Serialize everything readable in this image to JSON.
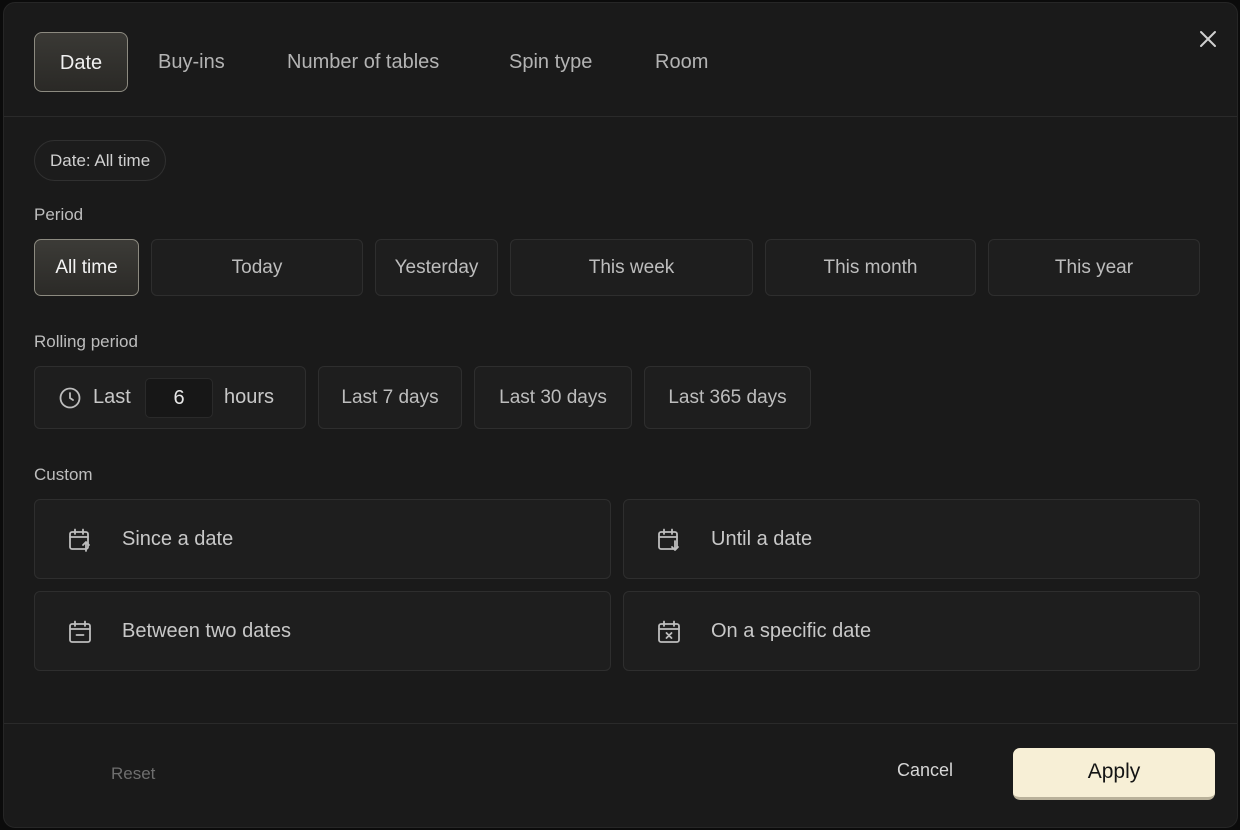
{
  "tabs": [
    "Date",
    "Buy-ins",
    "Number of tables",
    "Spin type",
    "Room"
  ],
  "active_tab": "Date",
  "chip": {
    "label": "Date: All time"
  },
  "period": {
    "label": "Period",
    "options": [
      "All time",
      "Today",
      "Yesterday",
      "This week",
      "This month",
      "This year"
    ],
    "selected": "All time"
  },
  "rolling": {
    "label": "Rolling period",
    "prefix": "Last",
    "value": "6",
    "unit": "hours",
    "options": [
      "Last 7 days",
      "Last 30 days",
      "Last 365 days"
    ]
  },
  "custom": {
    "label": "Custom",
    "options": [
      "Since a date",
      "Until a date",
      "Between two dates",
      "On a specific date"
    ]
  },
  "footer": {
    "reset": "Reset",
    "cancel": "Cancel",
    "apply": "Apply"
  },
  "colors": {
    "accent": "#f7efd6",
    "background": "#1a1a1a",
    "active_border": "#8c8a80"
  }
}
